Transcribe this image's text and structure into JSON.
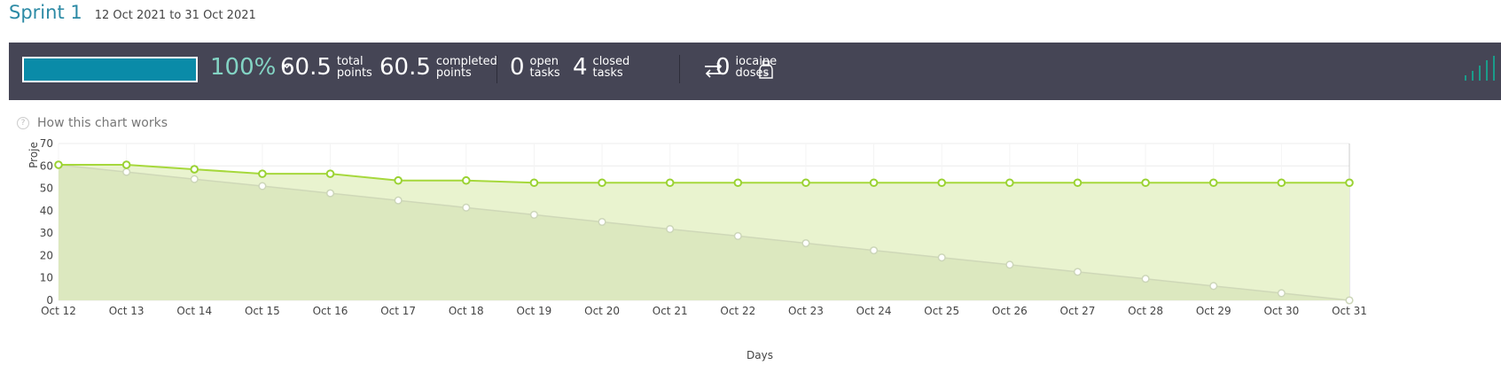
{
  "sprint": {
    "title": "Sprint 1",
    "dates": "12 Oct 2021 to 31 Oct 2021"
  },
  "stats": {
    "progress_fraction": 1.0,
    "percent": "100%",
    "total_points": "60.5",
    "total_label_1": "total",
    "total_label_2": "points",
    "completed_points": "60.5",
    "completed_label_1": "completed",
    "completed_label_2": "points",
    "open_tasks": "0",
    "open_label_1": "open",
    "open_label_2": "tasks",
    "closed_tasks": "4",
    "closed_label_1": "closed",
    "closed_label_2": "tasks",
    "iocaine": "0",
    "iocaine_label_1": "iocaine",
    "iocaine_label_2": "doses"
  },
  "icons": {
    "expand": "chevron-down-icon",
    "swap": "swap-arrows-icon",
    "iocaine": "potion-icon",
    "graph": "signal-bars-icon",
    "help": "question-icon"
  },
  "help_link": "How this chart works",
  "colors": {
    "accent": "#2c8aa5",
    "bar_bg": "#454555",
    "progress": "#0a8ba8",
    "percent": "#83d4c4",
    "real_line": "#a6d83c",
    "ideal_line": "#cfd8b8"
  },
  "chart_data": {
    "type": "area",
    "xlabel": "Days",
    "ylabel": "Proje",
    "ylim": [
      0,
      70
    ],
    "yticks": [
      0,
      10,
      20,
      30,
      40,
      50,
      60,
      70
    ],
    "categories": [
      "Oct 12",
      "Oct 13",
      "Oct 14",
      "Oct 15",
      "Oct 16",
      "Oct 17",
      "Oct 18",
      "Oct 19",
      "Oct 20",
      "Oct 21",
      "Oct 22",
      "Oct 23",
      "Oct 24",
      "Oct 25",
      "Oct 26",
      "Oct 27",
      "Oct 28",
      "Oct 29",
      "Oct 30",
      "Oct 31"
    ],
    "series": [
      {
        "key": "ideal",
        "values": [
          60.5,
          57.3,
          54.1,
          51.0,
          47.8,
          44.6,
          41.4,
          38.2,
          35.0,
          31.8,
          28.7,
          25.5,
          22.3,
          19.1,
          15.9,
          12.7,
          9.6,
          6.4,
          3.2,
          0
        ]
      },
      {
        "key": "real",
        "values": [
          60.5,
          60.5,
          58.5,
          56.5,
          56.5,
          53.5,
          53.5,
          52.5,
          52.5,
          52.5,
          52.5,
          52.5,
          52.5,
          52.5,
          52.5,
          52.5,
          52.5,
          52.5,
          52.5,
          52.5
        ]
      }
    ],
    "grid": true
  }
}
